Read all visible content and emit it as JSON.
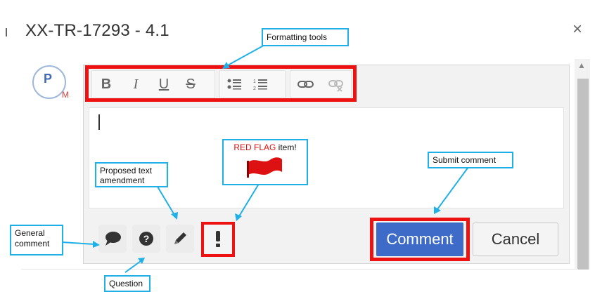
{
  "dialog": {
    "title": "XX-TR-17293 - 4.1",
    "close_label": "×"
  },
  "avatar": {
    "letter": "P",
    "sub": "M"
  },
  "toolbar": {
    "icons": [
      "bold-icon",
      "italic-icon",
      "underline-icon",
      "strikethrough-icon",
      "bulleted-list-icon",
      "numbered-list-icon",
      "link-icon",
      "unlink-icon"
    ],
    "bold": "B",
    "italic": "I",
    "underline": "U",
    "strike": "S"
  },
  "actions": {
    "icons": [
      "speech-bubble-icon",
      "question-icon",
      "pencil-icon",
      "exclamation-icon"
    ],
    "comment_label": "Comment",
    "cancel_label": "Cancel"
  },
  "annotations": {
    "formatting": "Formatting tools",
    "red_flag_prefix": "RED FLAG",
    "red_flag_suffix": " item!",
    "submit": "Submit comment",
    "proposed": "Proposed text amendment",
    "general": "General comment",
    "question": "Question"
  },
  "colors": {
    "highlight": "#ee1111",
    "callout_border": "#20b0e8",
    "primary": "#3e6bc7",
    "flag_red": "#dd1111"
  }
}
